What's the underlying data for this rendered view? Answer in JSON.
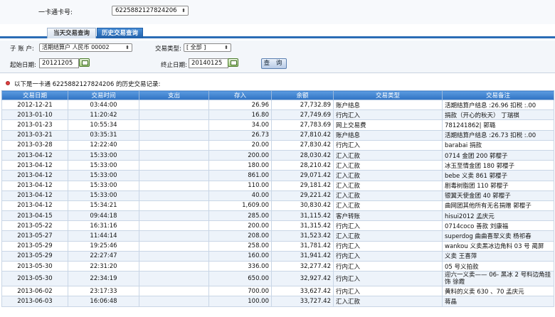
{
  "card": {
    "label": "一卡通卡号:",
    "value": "6225882127824206"
  },
  "tabs": [
    {
      "label": "当天交易查询"
    },
    {
      "label": "历史交易查询"
    }
  ],
  "form": {
    "sub_account_label": "子 账 户:",
    "sub_account_value": "活期结算户 人民币 00002",
    "txn_type_label": "交易类型:",
    "txn_type_value": "[ 全部 ]",
    "start_label": "起始日期:",
    "start_value": "20121205",
    "end_label": "终止日期:",
    "end_value": "20140125",
    "query_label": "查 询"
  },
  "info": {
    "prefix": "以下是一卡通",
    "card": "6225882127824206",
    "suffix": "的历史交易记录:"
  },
  "table": {
    "columns": [
      "交易日期",
      "交易时间",
      "支出",
      "存入",
      "余额",
      "交易类型",
      "交易备注"
    ],
    "rows": [
      [
        "2012-12-21",
        "03:44:00",
        "",
        "26.96",
        "27,732.89",
        "账户结息",
        "活期结算户结息 :26.96 扣税 :.00"
      ],
      [
        "2013-01-10",
        "11:20:42",
        "",
        "16.80",
        "27,749.69",
        "行内汇入",
        "捐款（开心的秋天） 丁瑞祺"
      ],
      [
        "2013-01-23",
        "10:55:34",
        "",
        "34.00",
        "27,783.69",
        "网上交易费",
        "781241862| 郭璐"
      ],
      [
        "2013-03-21",
        "03:35:31",
        "",
        "26.73",
        "27,810.42",
        "账户结息",
        "活期结算户结息 :26.73 扣税 :.00"
      ],
      [
        "2013-03-28",
        "12:22:40",
        "",
        "20.00",
        "27,830.42",
        "行内汇入",
        "barabai 捐款"
      ],
      [
        "2013-04-12",
        "15:33:00",
        "",
        "200.00",
        "28,030.42",
        "汇入汇款",
        "0714 金团 200 郭樱子"
      ],
      [
        "2013-04-12",
        "15:33:00",
        "",
        "180.00",
        "28,210.42",
        "汇入汇款",
        "冰玉至情金团 180 郭樱子"
      ],
      [
        "2013-04-12",
        "15:33:00",
        "",
        "861.00",
        "29,071.42",
        "汇入汇款",
        "bebe 义卖 861 郭樱子"
      ],
      [
        "2013-04-12",
        "15:33:00",
        "",
        "110.00",
        "29,181.42",
        "汇入汇款",
        "剧毒树脂团 110 郭樱子"
      ],
      [
        "2013-04-12",
        "15:33:00",
        "",
        "40.00",
        "29,221.42",
        "汇入汇款",
        "银翼天使金团 40 郭樱子"
      ],
      [
        "2013-04-12",
        "15:34:21",
        "",
        "1,609.00",
        "30,830.42",
        "汇入汇款",
        "曲网团其他所有无名捐赠 郭樱子"
      ],
      [
        "2013-04-15",
        "09:44:18",
        "",
        "285.00",
        "31,115.42",
        "客户转账",
        "hisui2012 孟庆元"
      ],
      [
        "2013-05-22",
        "16:31:16",
        "",
        "200.00",
        "31,315.42",
        "行内汇入",
        "0714coco 善款 刘康福"
      ],
      [
        "2013-05-27",
        "11:44:14",
        "",
        "208.00",
        "31,523.42",
        "汇入汇款",
        "superdog 曲曲喜翠义卖 杨祁春"
      ],
      [
        "2013-05-29",
        "19:25:46",
        "",
        "258.00",
        "31,781.42",
        "行内汇入",
        "wankou 义卖黑冰边角料 03 号 蔺屏"
      ],
      [
        "2013-05-29",
        "22:27:47",
        "",
        "160.00",
        "31,941.42",
        "行内汇入",
        "义卖 王喜萍"
      ],
      [
        "2013-05-30",
        "22:31:20",
        "",
        "336.00",
        "32,277.42",
        "行内汇入",
        "05 号义拍款"
      ],
      [
        "2013-05-30",
        "22:34:19",
        "",
        "650.00",
        "32,927.42",
        "行内汇入",
        "迎六一义卖—— 06- 黑冰 2 号料边角挂饰 徐霞"
      ],
      [
        "2013-06-02",
        "23:17:33",
        "",
        "700.00",
        "33,627.42",
        "行内汇入",
        "黄料的义卖 630 、70 孟庆元"
      ],
      [
        "2013-06-03",
        "16:06:48",
        "",
        "100.00",
        "33,727.42",
        "汇入汇款",
        "蒋晶"
      ]
    ]
  }
}
